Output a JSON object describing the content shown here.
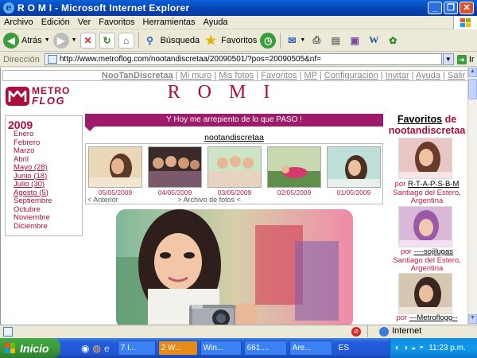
{
  "window": {
    "title": "R O M I - Microsoft Internet Explorer"
  },
  "menu": [
    "Archivo",
    "Edición",
    "Ver",
    "Favoritos",
    "Herramientas",
    "Ayuda"
  ],
  "toolbar": {
    "back": "Atrás",
    "search": "Búsqueda",
    "favorites": "Favoritos"
  },
  "address": {
    "label": "Dirección",
    "url": "http://www.metroflog.com/nootandiscretaa/20090501/?pos=20090505&nf=",
    "go": "Ir"
  },
  "page": {
    "nav": [
      "NooTanDiscretaa",
      "Mi muro",
      "Mis fotos",
      "Favoritos",
      "MP",
      "Configuración",
      "Invitar",
      "Ayuda",
      "Salir"
    ],
    "logo_top": "METRO",
    "logo_bottom": "FLOG",
    "site_title": "ROMI",
    "archive": {
      "year": "2009",
      "months": [
        "Enero",
        "Febrero",
        "Marzo",
        "Abril",
        "Mayo (28)",
        "Junio (18)",
        "Julio (30)",
        "Agosto (5)",
        "Septiembre",
        "Octubre",
        "Noviembre",
        "Diciembre"
      ]
    },
    "banner": "Y Hoy me arrepiento de lo que PASO !",
    "username": "nootandiscretaa",
    "thumb_dates": [
      "05/05/2009",
      "04/05/2009",
      "03/05/2009",
      "02/05/2009",
      "01/05/2009"
    ],
    "prev_label": "< Anterior",
    "archive_label": "> Archivo de fotos <",
    "favorites_title_1": "Favoritos",
    "favorites_title_2": "de nootandiscretaa",
    "favorites": [
      {
        "por": "por",
        "name": "R-T-A-P-S-B-M",
        "location": "Santiago del Estero, Argentina"
      },
      {
        "por": "por",
        "name": "----sojilugas",
        "location": "Santiago del Estero, Argentina"
      },
      {
        "por": "por",
        "name": "---Metroflogg--",
        "location": ""
      }
    ]
  },
  "status": {
    "zone": "Internet"
  },
  "taskbar": {
    "start": "Inicio",
    "tasks": [
      "7 I...",
      "2 W...",
      "Win...",
      "661....",
      "Are..."
    ],
    "lang": "ES",
    "clock": "11:23 p.m."
  },
  "colors": {
    "brand": "#aa0e3c",
    "banner": "#9e1a6a",
    "title_bar": "#0842b0"
  }
}
